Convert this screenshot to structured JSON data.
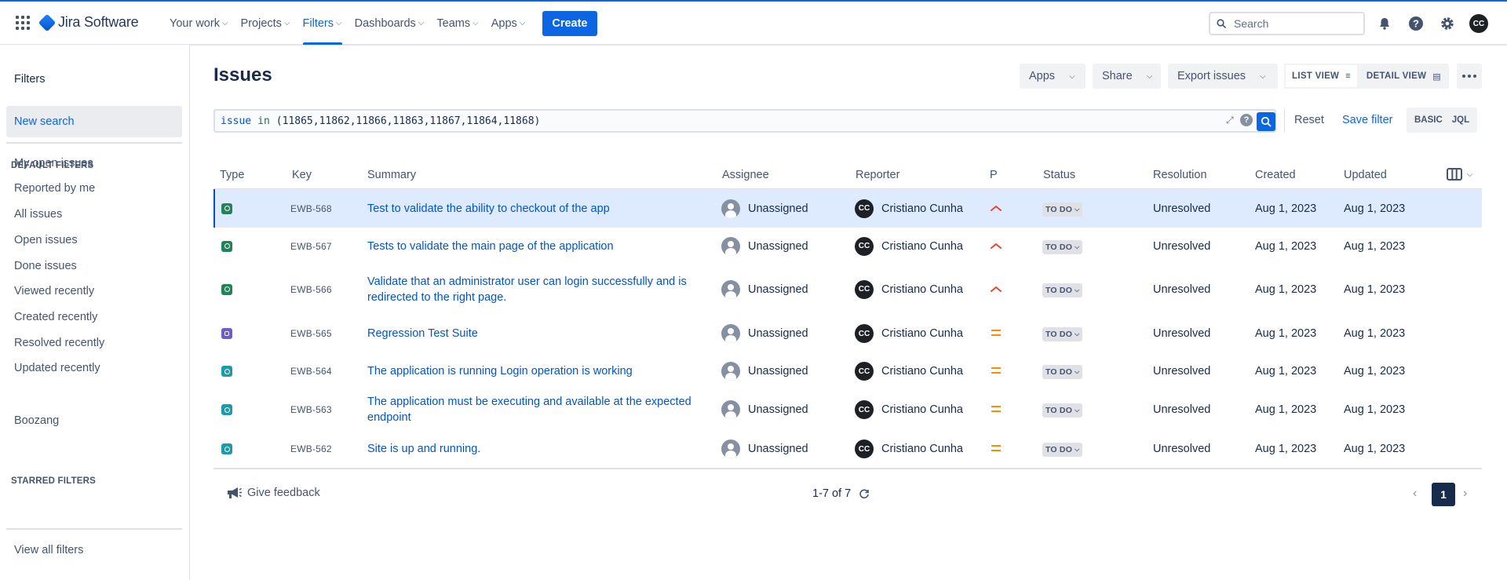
{
  "app": {
    "product": "Jira Software",
    "user_initials": "CC",
    "colors": {
      "brand": "#0c66e4",
      "link": "#0055cc",
      "priority_high": "#e34935",
      "priority_medium": "#ff8b00",
      "test_type": "#1f845a",
      "suite_type": "#6e5dc6",
      "precondition_type": "#1d9aaa"
    }
  },
  "topnav": {
    "items": [
      {
        "label": "Your work"
      },
      {
        "label": "Projects"
      },
      {
        "label": "Filters",
        "active": true
      },
      {
        "label": "Dashboards"
      },
      {
        "label": "Teams"
      },
      {
        "label": "Apps"
      }
    ],
    "create_label": "Create",
    "search_placeholder": "Search",
    "icons": [
      "notification-icon",
      "help-icon",
      "settings-icon"
    ]
  },
  "sidebar": {
    "title": "Filters",
    "new_search": "New search",
    "default_header": "DEFAULT FILTERS",
    "default_items": [
      "My open issues",
      "Reported by me",
      "All issues",
      "Open issues",
      "Done issues",
      "Viewed recently",
      "Created recently",
      "Resolved recently",
      "Updated recently"
    ],
    "starred_header": "STARRED FILTERS",
    "starred_items": [
      "Boozang"
    ],
    "view_all": "View all filters"
  },
  "main": {
    "title": "Issues",
    "buttons": {
      "apps": "Apps",
      "share": "Share",
      "export": "Export issues",
      "list_view": "LIST VIEW",
      "detail_view": "DETAIL VIEW"
    },
    "jql": {
      "field": "issue",
      "operator": "in",
      "value": "(11865,11862,11866,11863,11867,11864,11868)"
    },
    "reset": "Reset",
    "save_filter": "Save filter",
    "mode_basic": "BASIC",
    "mode_jql": "JQL",
    "columns": {
      "type": "Type",
      "key": "Key",
      "summary": "Summary",
      "assignee": "Assignee",
      "reporter": "Reporter",
      "priority": "P",
      "status": "Status",
      "resolution": "Resolution",
      "created": "Created",
      "updated": "Updated"
    },
    "rows": [
      {
        "type": "test",
        "key": "EWB-568",
        "summary": "Test to validate the ability to checkout of the app",
        "assignee": "Unassigned",
        "reporter": "Cristiano Cunha",
        "reporter_initials": "CC",
        "priority": "high",
        "status": "TO DO",
        "resolution": "Unresolved",
        "created": "Aug 1, 2023",
        "updated": "Aug 1, 2023"
      },
      {
        "type": "test",
        "key": "EWB-567",
        "summary": "Tests to validate the main page of the application",
        "assignee": "Unassigned",
        "reporter": "Cristiano Cunha",
        "reporter_initials": "CC",
        "priority": "high",
        "status": "TO DO",
        "resolution": "Unresolved",
        "created": "Aug 1, 2023",
        "updated": "Aug 1, 2023"
      },
      {
        "type": "test",
        "key": "EWB-566",
        "summary": "Validate that an administrator user can login successfully and is redirected to the right page.",
        "assignee": "Unassigned",
        "reporter": "Cristiano Cunha",
        "reporter_initials": "CC",
        "priority": "high",
        "status": "TO DO",
        "resolution": "Unresolved",
        "created": "Aug 1, 2023",
        "updated": "Aug 1, 2023"
      },
      {
        "type": "suite",
        "key": "EWB-565",
        "summary": "Regression Test Suite",
        "assignee": "Unassigned",
        "reporter": "Cristiano Cunha",
        "reporter_initials": "CC",
        "priority": "medium",
        "status": "TO DO",
        "resolution": "Unresolved",
        "created": "Aug 1, 2023",
        "updated": "Aug 1, 2023"
      },
      {
        "type": "precondition",
        "key": "EWB-564",
        "summary": "The application is running Login operation is working",
        "assignee": "Unassigned",
        "reporter": "Cristiano Cunha",
        "reporter_initials": "CC",
        "priority": "medium",
        "status": "TO DO",
        "resolution": "Unresolved",
        "created": "Aug 1, 2023",
        "updated": "Aug 1, 2023"
      },
      {
        "type": "precondition",
        "key": "EWB-563",
        "summary": "The application must be executing and available at the expected endpoint",
        "assignee": "Unassigned",
        "reporter": "Cristiano Cunha",
        "reporter_initials": "CC",
        "priority": "medium",
        "status": "TO DO",
        "resolution": "Unresolved",
        "created": "Aug 1, 2023",
        "updated": "Aug 1, 2023"
      },
      {
        "type": "precondition",
        "key": "EWB-562",
        "summary": "Site is up and running.",
        "assignee": "Unassigned",
        "reporter": "Cristiano Cunha",
        "reporter_initials": "CC",
        "priority": "medium",
        "status": "TO DO",
        "resolution": "Unresolved",
        "created": "Aug 1, 2023",
        "updated": "Aug 1, 2023"
      }
    ],
    "footer": {
      "feedback": "Give feedback",
      "count": "1-7 of 7",
      "page": "1"
    }
  }
}
